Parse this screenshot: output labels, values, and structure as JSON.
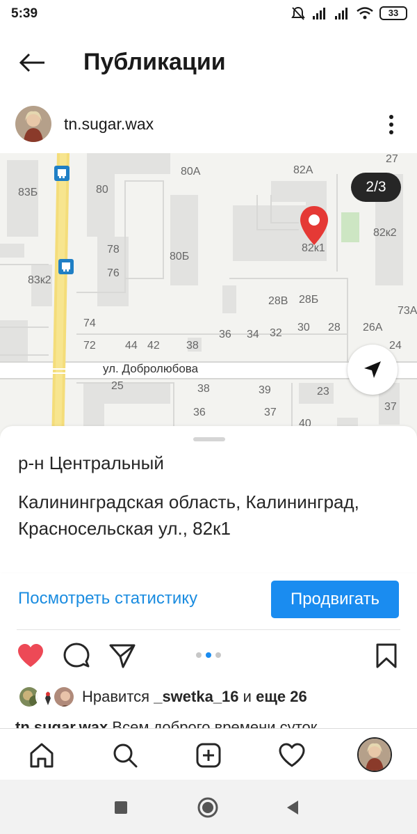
{
  "status_bar": {
    "time": "5:39",
    "battery": "33"
  },
  "header": {
    "title": "Публикации"
  },
  "post": {
    "username": "tn.sugar.wax"
  },
  "map": {
    "counter": "2/3",
    "street": "ул. Добролюбова",
    "labels": [
      "83Б",
      "80",
      "80А",
      "82А",
      "27",
      "78",
      "76",
      "80Б",
      "82к1",
      "82к2",
      "83к2",
      "28В",
      "28Б",
      "74",
      "72",
      "44",
      "42",
      "38",
      "36",
      "34",
      "32",
      "30",
      "28",
      "26А",
      "73А",
      "24",
      "25",
      "38",
      "39",
      "23",
      "36",
      "37",
      "37",
      "40"
    ]
  },
  "location": {
    "district": "р-н Центральный",
    "address": "Калининградская область, Калининград, Красносельская ул., 82к1"
  },
  "actions": {
    "stats_link": "Посмотреть статистику",
    "promote": "Продвигать"
  },
  "likes": {
    "prefix": "Нравится",
    "user": "_swetka_16",
    "conj": "и",
    "more": "еще 26"
  },
  "caption": {
    "user": "tn.sugar.wax",
    "text": "Всем доброго времени суток"
  },
  "colors": {
    "accent": "#1a8cf0",
    "like": "#ed4956",
    "pin": "#e53935"
  }
}
